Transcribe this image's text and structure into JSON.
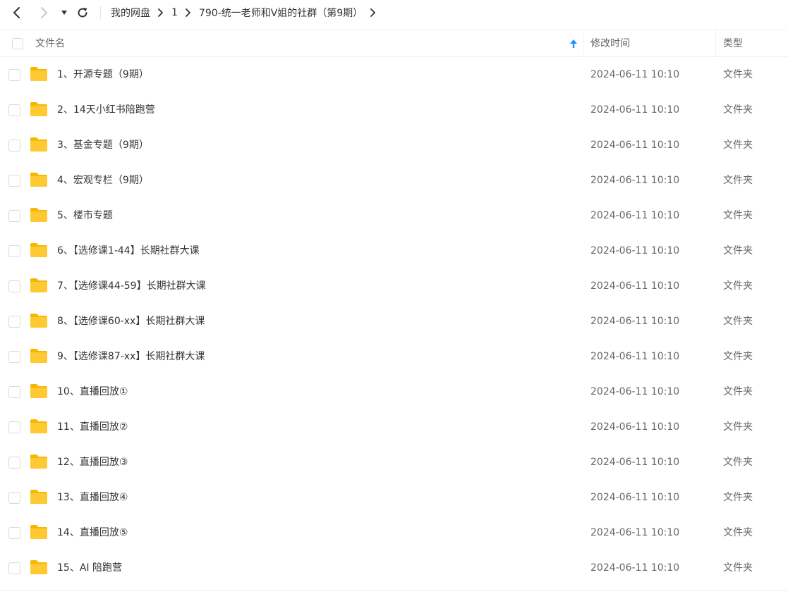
{
  "toolbar": {
    "back_icon": "chevron-left-icon",
    "forward_icon": "chevron-right-icon",
    "dropdown_icon": "caret-down-icon",
    "refresh_icon": "refresh-icon"
  },
  "breadcrumb": {
    "items": [
      "我的网盘",
      "1",
      "790-统一老师和V姐的社群（第9期）"
    ]
  },
  "table": {
    "columns": {
      "name": "文件名",
      "modified": "修改时间",
      "type": "类型"
    },
    "sort_icon": "sort-arrow-up-icon",
    "accent_color": "#1e90ff",
    "folder_color": "#ffc933",
    "rows": [
      {
        "name": "1、开源专题（9期）",
        "modified": "2024-06-11 10:10",
        "type": "文件夹"
      },
      {
        "name": "2、14天小红书陪跑营",
        "modified": "2024-06-11 10:10",
        "type": "文件夹"
      },
      {
        "name": "3、基金专题（9期）",
        "modified": "2024-06-11 10:10",
        "type": "文件夹"
      },
      {
        "name": "4、宏观专栏（9期）",
        "modified": "2024-06-11 10:10",
        "type": "文件夹"
      },
      {
        "name": "5、楼市专题",
        "modified": "2024-06-11 10:10",
        "type": "文件夹"
      },
      {
        "name": "6、【选修课1-44】长期社群大课",
        "modified": "2024-06-11 10:10",
        "type": "文件夹"
      },
      {
        "name": "7、【选修课44-59】长期社群大课",
        "modified": "2024-06-11 10:10",
        "type": "文件夹"
      },
      {
        "name": "8、【选修课60-xx】长期社群大课",
        "modified": "2024-06-11 10:10",
        "type": "文件夹"
      },
      {
        "name": "9、【选修课87-xx】长期社群大课",
        "modified": "2024-06-11 10:10",
        "type": "文件夹"
      },
      {
        "name": "10、直播回放①",
        "modified": "2024-06-11 10:10",
        "type": "文件夹"
      },
      {
        "name": "11、直播回放②",
        "modified": "2024-06-11 10:10",
        "type": "文件夹"
      },
      {
        "name": "12、直播回放③",
        "modified": "2024-06-11 10:10",
        "type": "文件夹"
      },
      {
        "name": "13、直播回放④",
        "modified": "2024-06-11 10:10",
        "type": "文件夹"
      },
      {
        "name": "14、直播回放⑤",
        "modified": "2024-06-11 10:10",
        "type": "文件夹"
      },
      {
        "name": "15、AI 陪跑营",
        "modified": "2024-06-11 10:10",
        "type": "文件夹"
      }
    ]
  }
}
